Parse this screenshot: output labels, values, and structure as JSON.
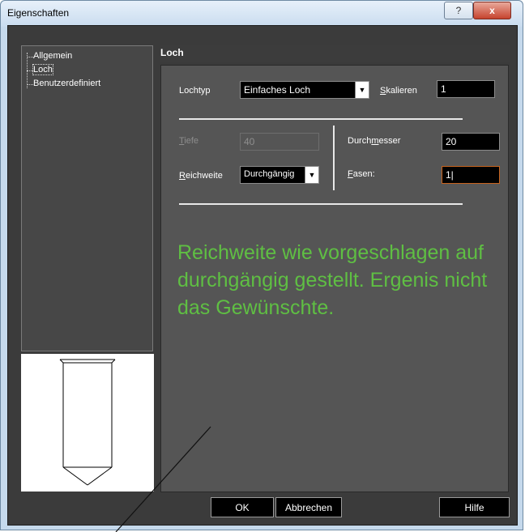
{
  "window": {
    "title": "Eigenschaften",
    "help_glyph": "?",
    "close_glyph": "x"
  },
  "tree": {
    "items": [
      "Allgemein",
      "Loch",
      "Benutzerdefiniert"
    ]
  },
  "panel": {
    "title": "Loch",
    "lochtyp": {
      "label": "Lochtyp",
      "value": "Einfaches Loch"
    },
    "skalieren": {
      "label_prefix": "S",
      "label_rest": "kalieren",
      "value": "1"
    },
    "tiefe": {
      "label_prefix": "T",
      "label_rest": "iefe",
      "value": "40"
    },
    "durchmesser": {
      "label_a": "Durch",
      "label_u": "m",
      "label_b": "esser",
      "value": "20"
    },
    "reichweite": {
      "label_prefix": "R",
      "label_rest": "eichweite",
      "value": "Durchgängig"
    },
    "fasen": {
      "label_prefix": "F",
      "label_rest": "asen:",
      "value": "1|"
    }
  },
  "annotation": {
    "text": "Reichweite wie vorgeschlagen auf durchgängig gestellt. Ergenis nicht das Gewünschte.",
    "color": "#5fbf43"
  },
  "buttons": {
    "ok": "OK",
    "cancel": "Abbrechen",
    "help": "Hilfe"
  }
}
